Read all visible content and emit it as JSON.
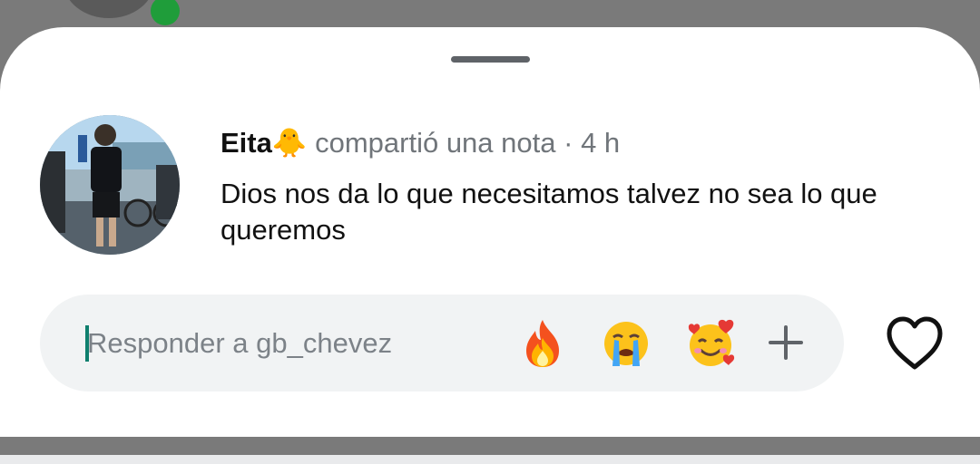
{
  "note": {
    "author": "Eita",
    "author_emoji": "🐥",
    "action": "compartió una nota",
    "separator": "·",
    "time": "4 h",
    "text": "Dios nos da lo que necesitamos talvez no sea lo que queremos"
  },
  "reply": {
    "placeholder": "Responder a gb_chevez",
    "quick_reactions": [
      {
        "icon": "fire-emoji-icon",
        "glyph": "🔥"
      },
      {
        "icon": "crying-emoji-icon",
        "glyph": "😭"
      },
      {
        "icon": "smiling-face-with-hearts-emoji-icon",
        "glyph": "🥰"
      }
    ],
    "more_icon": "plus-icon"
  },
  "like_icon": "heart-outline-icon",
  "colors": {
    "backdrop": "#7a7a7a",
    "sheet": "#ffffff",
    "input_bg": "#f1f3f4",
    "caret": "#0f7f6e",
    "secondary_text": "#70757a",
    "online_dot": "#1f9d3a"
  }
}
